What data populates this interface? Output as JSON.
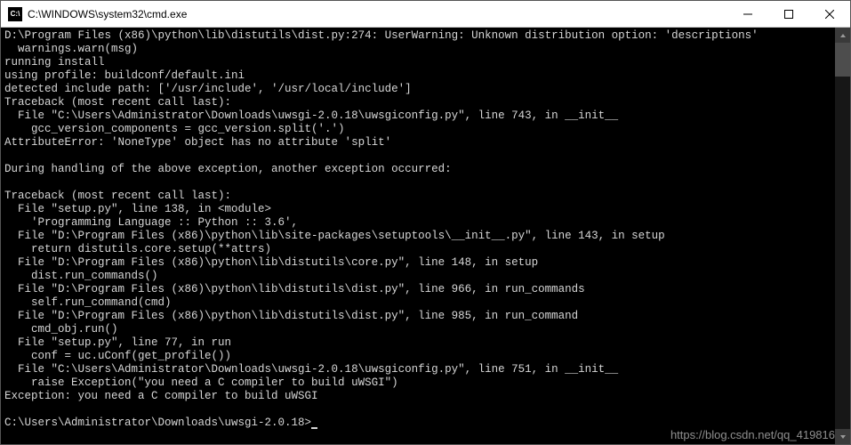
{
  "titlebar": {
    "icon_label": "C:\\",
    "title": "C:\\WINDOWS\\system32\\cmd.exe"
  },
  "console": {
    "lines": [
      "D:\\Program Files (x86)\\python\\lib\\distutils\\dist.py:274: UserWarning: Unknown distribution option: 'descriptions'",
      "  warnings.warn(msg)",
      "running install",
      "using profile: buildconf/default.ini",
      "detected include path: ['/usr/include', '/usr/local/include']",
      "Traceback (most recent call last):",
      "  File \"C:\\Users\\Administrator\\Downloads\\uwsgi-2.0.18\\uwsgiconfig.py\", line 743, in __init__",
      "    gcc_version_components = gcc_version.split('.')",
      "AttributeError: 'NoneType' object has no attribute 'split'",
      "",
      "During handling of the above exception, another exception occurred:",
      "",
      "Traceback (most recent call last):",
      "  File \"setup.py\", line 138, in <module>",
      "    'Programming Language :: Python :: 3.6',",
      "  File \"D:\\Program Files (x86)\\python\\lib\\site-packages\\setuptools\\__init__.py\", line 143, in setup",
      "    return distutils.core.setup(**attrs)",
      "  File \"D:\\Program Files (x86)\\python\\lib\\distutils\\core.py\", line 148, in setup",
      "    dist.run_commands()",
      "  File \"D:\\Program Files (x86)\\python\\lib\\distutils\\dist.py\", line 966, in run_commands",
      "    self.run_command(cmd)",
      "  File \"D:\\Program Files (x86)\\python\\lib\\distutils\\dist.py\", line 985, in run_command",
      "    cmd_obj.run()",
      "  File \"setup.py\", line 77, in run",
      "    conf = uc.uConf(get_profile())",
      "  File \"C:\\Users\\Administrator\\Downloads\\uwsgi-2.0.18\\uwsgiconfig.py\", line 751, in __init__",
      "    raise Exception(\"you need a C compiler to build uWSGI\")",
      "Exception: you need a C compiler to build uWSGI",
      ""
    ],
    "prompt": "C:\\Users\\Administrator\\Downloads\\uwsgi-2.0.18>"
  },
  "watermark": "https://blog.csdn.net/qq_419816"
}
